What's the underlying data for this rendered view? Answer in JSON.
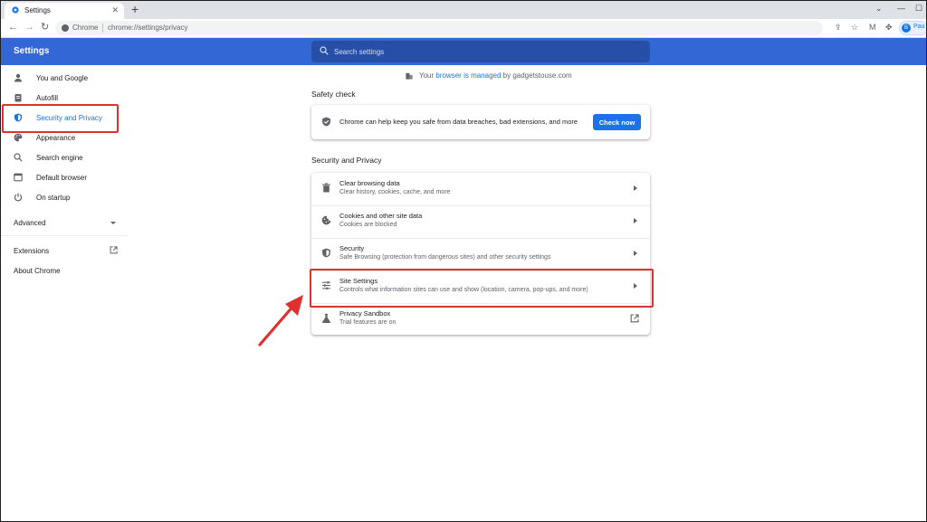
{
  "browser": {
    "tab_title": "Settings",
    "new_tab": "+",
    "omnibox_chip": "Chrome",
    "url": "chrome://settings/privacy",
    "profile_initial": "B",
    "profile_name": "Pau"
  },
  "header": {
    "title": "Settings",
    "search_placeholder": "Search settings"
  },
  "sidebar": {
    "items": [
      {
        "label": "You and Google",
        "icon": "person-icon"
      },
      {
        "label": "Autofill",
        "icon": "clipboard-icon"
      },
      {
        "label": "Security and Privacy",
        "icon": "shield-icon",
        "active": true
      },
      {
        "label": "Appearance",
        "icon": "palette-icon"
      },
      {
        "label": "Search engine",
        "icon": "search-icon"
      },
      {
        "label": "Default browser",
        "icon": "browser-icon"
      },
      {
        "label": "On startup",
        "icon": "power-icon"
      }
    ],
    "advanced": "Advanced",
    "extensions": "Extensions",
    "about": "About Chrome"
  },
  "managed": {
    "prefix": "Your ",
    "link": "browser is managed",
    "suffix": " by gadgetstouse.com"
  },
  "safety_check": {
    "title": "Safety check",
    "text": "Chrome can help keep you safe from data breaches, bad extensions, and more",
    "button": "Check now"
  },
  "privacy": {
    "title": "Security and Privacy",
    "rows": [
      {
        "title": "Clear browsing data",
        "subtitle": "Clear history, cookies, cache, and more",
        "icon": "trash-icon"
      },
      {
        "title": "Cookies and other site data",
        "subtitle": "Cookies are blocked",
        "icon": "cookie-icon"
      },
      {
        "title": "Security",
        "subtitle": "Safe Browsing (protection from dangerous sites) and other security settings",
        "icon": "shield-icon"
      },
      {
        "title": "Site Settings",
        "subtitle": "Controls what information sites can use and show (location, camera, pop-ups, and more)",
        "icon": "tune-icon"
      },
      {
        "title": "Privacy Sandbox",
        "subtitle": "Trial features are on",
        "icon": "flask-icon"
      }
    ]
  },
  "colors": {
    "header_blue": "#3367d6",
    "accent": "#1a73e8",
    "highlight_red": "#e03131"
  }
}
